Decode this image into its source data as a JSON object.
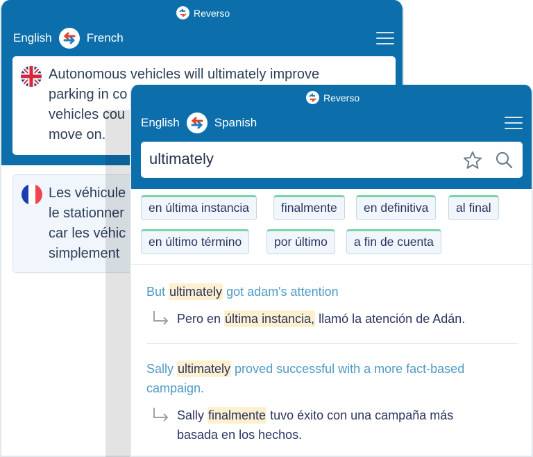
{
  "back_panel": {
    "brand": "Reverso",
    "source_lang": "English",
    "target_lang": "French",
    "source_text": [
      "Autonomous vehicles will ultimately improve",
      "parking in co",
      "vehicles cou",
      "move on."
    ],
    "translation_text": [
      "Les véhicule",
      "le stationner",
      "car les véhic",
      "simplement"
    ],
    "source_flag": "uk-flag",
    "target_flag": "france-flag"
  },
  "front_panel": {
    "brand": "Reverso",
    "source_lang": "English",
    "target_lang": "Spanish",
    "search": {
      "value": "ultimately"
    },
    "translations": [
      "en última instancia",
      "finalmente",
      "en definitiva",
      "al final",
      "en último término",
      "por último",
      "a fin de cuenta"
    ],
    "examples": [
      {
        "src_before": "But ",
        "src_hl": "ultimately",
        "src_after": " got adam's attention",
        "tgt_before": "Pero en ",
        "tgt_hl": "última instancia,",
        "tgt_after": " llamó la atención de Adán."
      },
      {
        "src_before": "Sally ",
        "src_hl": "ultimately",
        "src_after": " proved successful with a more fact-based campaign.",
        "tgt_before": "Sally ",
        "tgt_hl": "finalmente",
        "tgt_after": " tuvo éxito con una campaña más basada en los hechos."
      }
    ]
  },
  "colors": {
    "brand_blue": "#0c6fab",
    "swap_red": "#e2442b",
    "swap_blue": "#1f7fc4",
    "chip_accent": "#7bd3a8",
    "highlight": "#fdf0cf",
    "example_source": "#4d9ac4",
    "example_target": "#2b3360"
  }
}
